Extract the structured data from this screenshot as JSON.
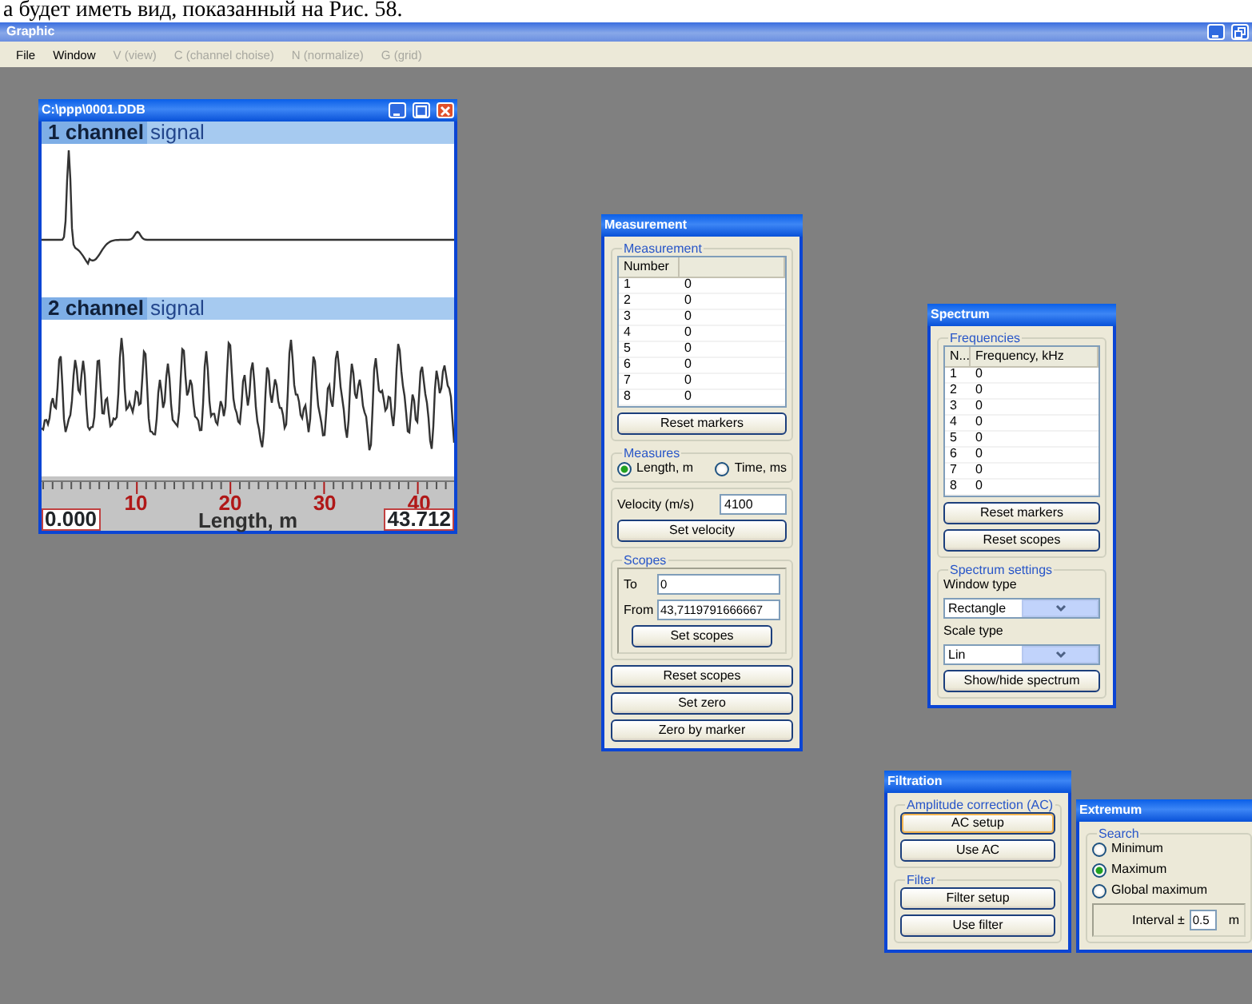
{
  "document_text": "а будет иметь вид, показанный на Рис. 58.",
  "app": {
    "title": "Graphic",
    "menu": [
      {
        "label": "File",
        "disabled": false
      },
      {
        "label": "Window",
        "disabled": false
      },
      {
        "label": "V (view)",
        "disabled": true
      },
      {
        "label": "C (channel choise)",
        "disabled": true
      },
      {
        "label": "N (normalize)",
        "disabled": true
      },
      {
        "label": "G (grid)",
        "disabled": true
      }
    ]
  },
  "signal_window": {
    "title": "C:\\ppp\\0001.DDB",
    "channels": [
      {
        "name": "1 channel",
        "label": "signal",
        "kind": "pulse"
      },
      {
        "name": "2 channel",
        "label": "signal",
        "kind": "noise"
      }
    ],
    "ruler": {
      "ticks": [
        "10",
        "20",
        "30",
        "40"
      ],
      "start": "0.000",
      "label": "Length, m",
      "end": "43.712"
    }
  },
  "measurement": {
    "title": "Measurement",
    "group": "Measurement",
    "column": "Number",
    "rows": [
      {
        "number": "1",
        "value": "0"
      },
      {
        "number": "2",
        "value": "0"
      },
      {
        "number": "3",
        "value": "0"
      },
      {
        "number": "4",
        "value": "0"
      },
      {
        "number": "5",
        "value": "0"
      },
      {
        "number": "6",
        "value": "0"
      },
      {
        "number": "7",
        "value": "0"
      },
      {
        "number": "8",
        "value": "0"
      }
    ],
    "reset_button": "Reset markers",
    "measures": {
      "title": "Measures",
      "options": [
        {
          "label": "Length, m",
          "selected": true
        },
        {
          "label": "Time, ms",
          "selected": false
        }
      ]
    },
    "velocity": {
      "label": "Velocity (m/s)",
      "value": "4100",
      "button": "Set velocity"
    },
    "scopes": {
      "title": "Scopes",
      "fields": [
        {
          "label": "To",
          "value": "0"
        },
        {
          "label": "From",
          "value": "43,7119791666667"
        }
      ],
      "button": "Set scopes"
    },
    "buttons": [
      "Reset scopes",
      "Set zero",
      "Zero by marker"
    ]
  },
  "spectrum": {
    "title": "Spectrum",
    "group": "Frequencies",
    "columns": [
      "N...",
      "Frequency, kHz"
    ],
    "rows": [
      {
        "number": "1",
        "value": "0"
      },
      {
        "number": "2",
        "value": "0"
      },
      {
        "number": "3",
        "value": "0"
      },
      {
        "number": "4",
        "value": "0"
      },
      {
        "number": "5",
        "value": "0"
      },
      {
        "number": "6",
        "value": "0"
      },
      {
        "number": "7",
        "value": "0"
      },
      {
        "number": "8",
        "value": "0"
      }
    ],
    "buttons": [
      "Reset markers",
      "Reset scopes"
    ],
    "settings": {
      "title": "Spectrum settings",
      "selects": [
        {
          "label": "Window type",
          "value": "Rectangle"
        },
        {
          "label": "Scale type",
          "value": "Lin"
        }
      ],
      "button": "Show/hide spectrum"
    }
  },
  "filtration": {
    "title": "Filtration",
    "groups": [
      {
        "title": "Amplitude correction (AC)",
        "buttons": [
          {
            "label": "AC setup",
            "focused": true
          },
          {
            "label": "Use AC",
            "focused": false
          }
        ]
      },
      {
        "title": "Filter",
        "buttons": [
          {
            "label": "Filter setup",
            "focused": false
          },
          {
            "label": "Use filter",
            "focused": false
          }
        ]
      }
    ]
  },
  "extremum": {
    "title": "Extremum",
    "search": {
      "title": "Search",
      "options": [
        {
          "label": "Minimum",
          "selected": false
        },
        {
          "label": "Maximum",
          "selected": true
        },
        {
          "label": "Global maximum",
          "selected": false
        }
      ]
    },
    "interval": {
      "label": "Interval ±",
      "value": "0.5",
      "unit": "m"
    }
  }
}
